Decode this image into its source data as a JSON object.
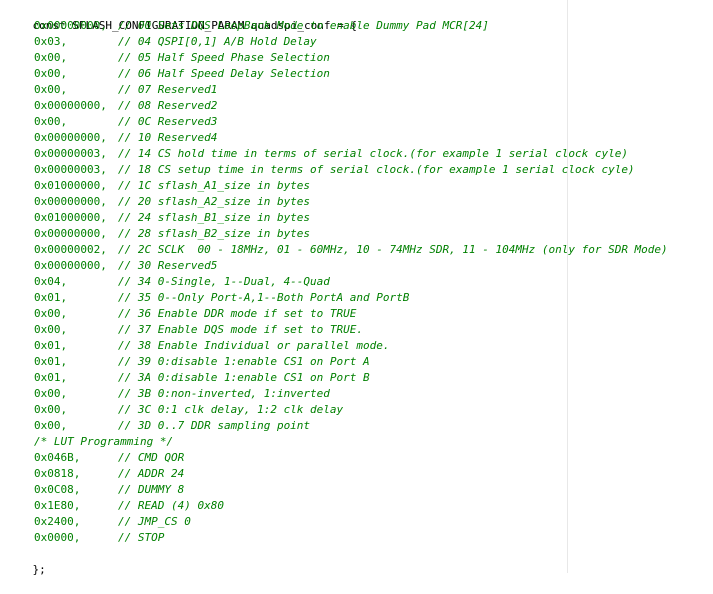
{
  "declaration": "const SFLASH_CONFIGURATION_PARAM quadspi_conf = {",
  "entries": [
    {
      "value": "0x00000000,",
      "comment": "// 00 Sets DQS LoopBack Mode to enable Dummy Pad MCR[24]"
    },
    {
      "value": "0x03,",
      "comment": "// 04 QSPI[0,1] A/B Hold Delay"
    },
    {
      "value": "0x00,",
      "comment": "// 05 Half Speed Phase Selection"
    },
    {
      "value": "0x00,",
      "comment": "// 06 Half Speed Delay Selection"
    },
    {
      "value": "0x00,",
      "comment": "// 07 Reserved1"
    },
    {
      "value": "0x00000000,",
      "comment": "// 08 Reserved2"
    },
    {
      "value": "0x00,",
      "comment": "// 0C Reserved3"
    },
    {
      "value": "0x00000000,",
      "comment": "// 10 Reserved4"
    },
    {
      "value": "0x00000003,",
      "comment": "// 14 CS hold time in terms of serial clock.(for example 1 serial clock cyle)"
    },
    {
      "value": "0x00000003,",
      "comment": "// 18 CS setup time in terms of serial clock.(for example 1 serial clock cyle)"
    },
    {
      "value": "0x01000000,",
      "comment": "// 1C sflash_A1_size in bytes"
    },
    {
      "value": "0x00000000,",
      "comment": "// 20 sflash_A2_size in bytes"
    },
    {
      "value": "0x01000000,",
      "comment": "// 24 sflash_B1_size in bytes"
    },
    {
      "value": "0x00000000,",
      "comment": "// 28 sflash_B2_size in bytes"
    },
    {
      "value": "0x00000002,",
      "comment": "// 2C SCLK  00 - 18MHz, 01 - 60MHz, 10 - 74MHz SDR, 11 - 104MHz (only for SDR Mode)"
    },
    {
      "value": "0x00000000,",
      "comment": "// 30 Reserved5"
    },
    {
      "value": "0x04,",
      "comment": "// 34 0-Single, 1--Dual, 4--Quad"
    },
    {
      "value": "0x01,",
      "comment": "// 35 0--Only Port-A,1--Both PortA and PortB"
    },
    {
      "value": "0x00,",
      "comment": "// 36 Enable DDR mode if set to TRUE"
    },
    {
      "value": "0x00,",
      "comment": "// 37 Enable DQS mode if set to TRUE."
    },
    {
      "value": "0x01,",
      "comment": "// 38 Enable Individual or parallel mode."
    },
    {
      "value": "0x01,",
      "comment": "// 39 0:disable 1:enable CS1 on Port A"
    },
    {
      "value": "0x01,",
      "comment": "// 3A 0:disable 1:enable CS1 on Port B"
    },
    {
      "value": "0x00,",
      "comment": "// 3B 0:non-inverted, 1:inverted"
    },
    {
      "value": "0x00,",
      "comment": "// 3C 0:1 clk delay, 1:2 clk delay"
    },
    {
      "value": "0x00,",
      "comment": "// 3D 0..7 DDR sampling point"
    }
  ],
  "lut_comment": "/* LUT Programming */",
  "lut_entries": [
    {
      "value": "0x046B,",
      "comment": "// CMD QOR"
    },
    {
      "value": "0x0818,",
      "comment": "// ADDR 24"
    },
    {
      "value": "0x0C08,",
      "comment": "// DUMMY 8"
    },
    {
      "value": "0x1E80,",
      "comment": "// READ (4) 0x80"
    },
    {
      "value": "0x2400,",
      "comment": "// JMP_CS 0"
    },
    {
      "value": "0x0000,",
      "comment": "// STOP"
    }
  ],
  "closing": "};"
}
